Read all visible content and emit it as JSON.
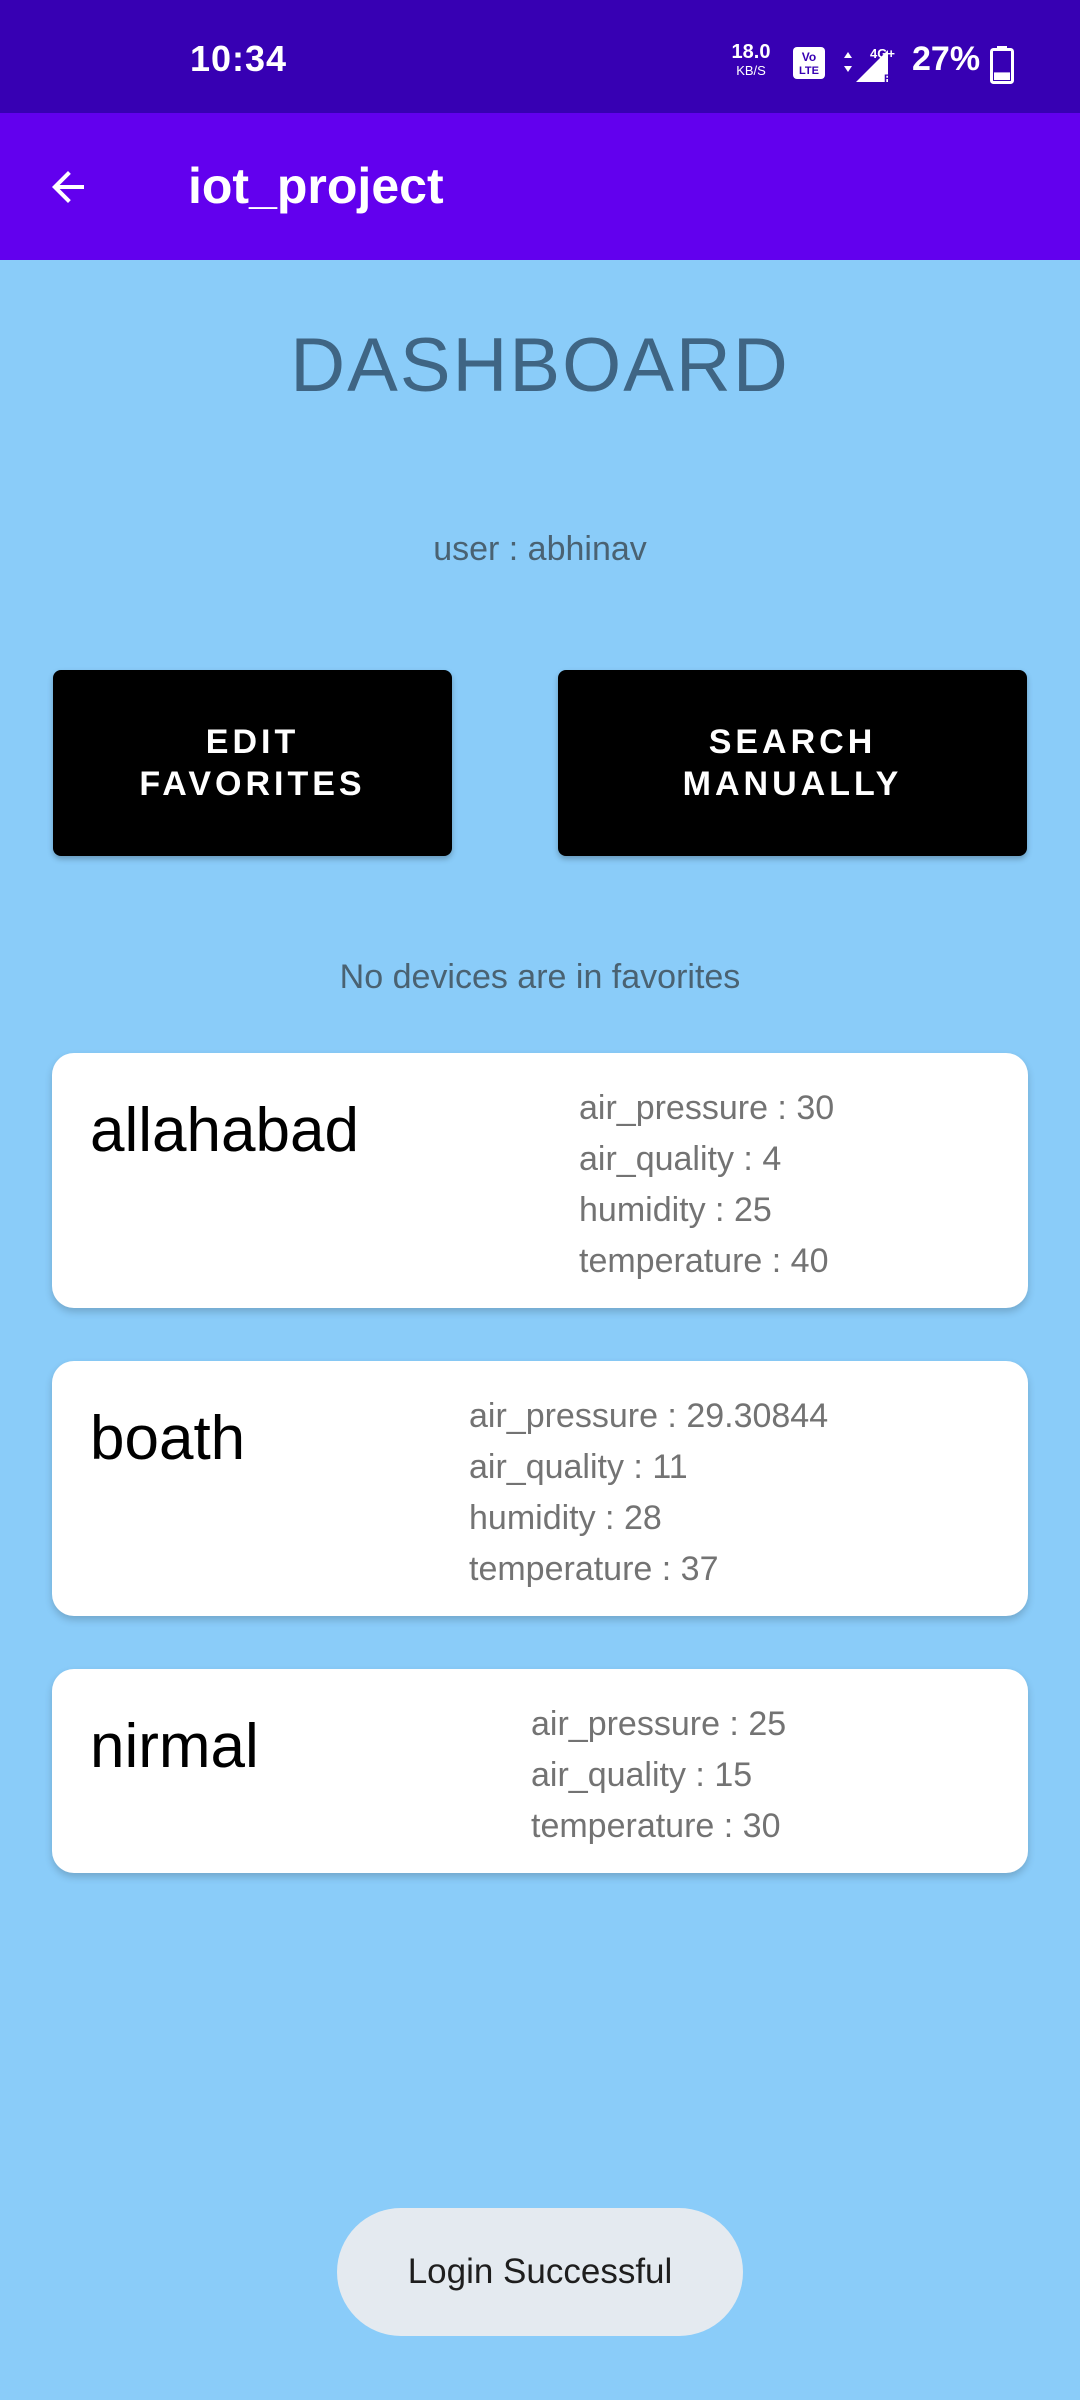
{
  "status_bar": {
    "time": "10:34",
    "net_speed_value": "18.0",
    "net_speed_unit": "KB/S",
    "volte_label": "Vo LTE",
    "network_label": "4G+",
    "battery_percent": "27%",
    "battery_level": 0.27
  },
  "app_bar": {
    "title": "iot_project",
    "back_icon": "arrow-left-icon"
  },
  "main": {
    "title": "DASHBOARD",
    "user_label": "user : abhinav",
    "edit_favorites_line1": "EDIT",
    "edit_favorites_line2": "FAVORITES",
    "search_manually_line1": "SEARCH",
    "search_manually_line2": "MANUALLY",
    "favorites_empty": "No devices are in favorites"
  },
  "devices": [
    {
      "name": "allahabad",
      "readings": [
        "air_pressure : 30",
        "air_quality : 4",
        "humidity : 25",
        "temperature : 40"
      ]
    },
    {
      "name": "boath",
      "readings": [
        "air_pressure : 29.30844",
        "air_quality : 11",
        "humidity : 28",
        "temperature : 37"
      ]
    },
    {
      "name": "nirmal",
      "readings": [
        "air_pressure : 25",
        "air_quality : 15",
        "temperature : 30"
      ]
    }
  ],
  "toast": {
    "message": "Login Successful"
  },
  "colors": {
    "status_bar": "#3700B3",
    "app_bar": "#6200EE",
    "background": "#8ACCF9",
    "button": "#000000",
    "card": "#FFFFFF",
    "toast": "#E4EAF0"
  }
}
